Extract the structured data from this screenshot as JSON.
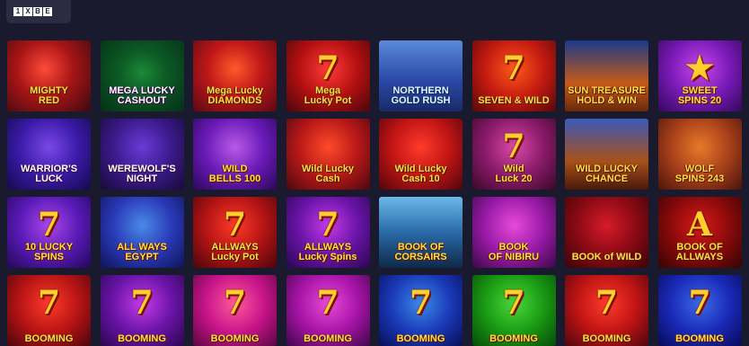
{
  "provider_logo": [
    "1",
    "X",
    "B",
    "E"
  ],
  "games": [
    {
      "title": "MIGHTY\nRED",
      "glyph": "",
      "bg": "radial-gradient(circle at 45% 40%, #ff4a3a 0%, #a81515 45%, #3a0a12 100%)",
      "text": "yellow"
    },
    {
      "title": "MEGA LUCKY\nCASHOUT",
      "glyph": "",
      "bg": "radial-gradient(ellipse at 50% 45%, #1a8a3a 0%, #0d5a24 40%, #043018 100%)",
      "text": "white"
    },
    {
      "title": "Mega Lucky\nDIAMONDS",
      "glyph": "",
      "bg": "radial-gradient(circle at 50% 40%, #ff5a2a 0%, #c01818 45%, #5a0814 100%)",
      "text": "yellow"
    },
    {
      "title": "Mega\nLucky Pot",
      "glyph": "7",
      "bg": "radial-gradient(circle at 50% 40%, #ff3b3b 0%, #b41010 50%, #4a060c 100%)",
      "text": "yellow"
    },
    {
      "title": "NORTHERN\nGOLD RUSH",
      "glyph": "",
      "bg": "linear-gradient(180deg, #5a8ad8 0%, #2a4aa8 55%, #1a2a6a 100%)",
      "text": "cyan"
    },
    {
      "title": "SEVEN & WILD",
      "glyph": "7",
      "bg": "radial-gradient(circle at 50% 40%, #ff5a1a 0%, #c41a10 50%, #560808 100%)",
      "text": "yellow"
    },
    {
      "title": "SUN TREASURE\nHOLD & WIN",
      "glyph": "",
      "bg": "linear-gradient(180deg, #1a3a8a 0%, #c45a1a 60%, #6a2a0a 100%)",
      "text": "yellow"
    },
    {
      "title": "SWEET\nSPINS 20",
      "glyph": "★",
      "bg": "radial-gradient(circle at 50% 40%, #c848e8 0%, #7a1ab8 50%, #34085a 100%)",
      "text": "yellow"
    },
    {
      "title": "WARRIOR'S\nLUCK",
      "glyph": "",
      "bg": "radial-gradient(circle at 50% 40%, #7a48e8 0%, #3a1aa8 50%, #140a4a 100%)",
      "text": "white"
    },
    {
      "title": "WEREWOLF'S\nNIGHT",
      "glyph": "",
      "bg": "radial-gradient(circle at 50% 40%, #6a3ad8 0%, #3a1a8a 50%, #180a3a 100%)",
      "text": "white"
    },
    {
      "title": "WILD\nBELLS 100",
      "glyph": "",
      "bg": "radial-gradient(circle at 50% 40%, #b85ae8 0%, #6a1ab8 50%, #2a0858 100%)",
      "text": "yellow"
    },
    {
      "title": "Wild Lucky\nCash",
      "glyph": "",
      "bg": "radial-gradient(circle at 50% 40%, #ff4a2a 0%, #b81818 50%, #4a0810 100%)",
      "text": "yellow"
    },
    {
      "title": "Wild Lucky\nCash 10",
      "glyph": "",
      "bg": "radial-gradient(circle at 50% 40%, #ff3a2a 0%, #c01414 50%, #4e060e 100%)",
      "text": "yellow"
    },
    {
      "title": "Wild\nLuck 20",
      "glyph": "7",
      "bg": "radial-gradient(circle at 50% 40%, #d84aa8 0%, #8a1a6a 50%, #3a0828 100%)",
      "text": "yellow"
    },
    {
      "title": "WILD LUCKY\nCHANCE",
      "glyph": "",
      "bg": "linear-gradient(180deg, #3a5ab8 0%, #a8501a 60%, #4a1a0a 100%)",
      "text": "yellow"
    },
    {
      "title": "WOLF\nSPINS 243",
      "glyph": "",
      "bg": "radial-gradient(circle at 50% 40%, #e87a2a 0%, #a8401a 50%, #4a140a 100%)",
      "text": "yellow"
    },
    {
      "title": "10 LUCKY\nSPINS",
      "glyph": "7",
      "bg": "radial-gradient(circle at 50% 40%, #a848e8 0%, #5a1ab8 50%, #220858 100%)",
      "text": "yellow"
    },
    {
      "title": "ALL WAYS\nEGYPT",
      "glyph": "",
      "bg": "radial-gradient(circle at 50% 40%, #4a8ae8 0%, #2a3ab8 50%, #0e1458 100%)",
      "text": "yellow"
    },
    {
      "title": "ALLWAYS\nLucky Pot",
      "glyph": "7",
      "bg": "radial-gradient(circle at 50% 40%, #ff3a2a 0%, #b41414 50%, #4a060c 100%)",
      "text": "yellow"
    },
    {
      "title": "ALLWAYS\nLucky Spins",
      "glyph": "7",
      "bg": "radial-gradient(circle at 50% 40%, #c43ae8 0%, #6a14a8 50%, #2a0650 100%)",
      "text": "yellow"
    },
    {
      "title": "BOOK OF\nCORSAIRS",
      "glyph": "",
      "bg": "linear-gradient(180deg, #6ab8e8 0%, #2a6aa8 50%, #0e2a4a 100%)",
      "text": "yellow"
    },
    {
      "title": "BOOK\nOF NIBIRU",
      "glyph": "",
      "bg": "radial-gradient(circle at 50% 40%, #e84ad8 0%, #9a1aa8 50%, #3a0848 100%)",
      "text": "yellow"
    },
    {
      "title": "BOOK of WILD",
      "glyph": "",
      "bg": "radial-gradient(circle at 50% 40%, #d81a2a 0%, #8a0a14 50%, #3a0408 100%)",
      "text": "yellow"
    },
    {
      "title": "BOOK OF\nALLWAYS",
      "glyph": "A",
      "bg": "radial-gradient(circle at 50% 40%, #d81a1a 0%, #8a0a0a 50%, #340404 100%)",
      "text": "yellow"
    },
    {
      "title": "BOOMING",
      "glyph": "7",
      "bg": "radial-gradient(circle at 50% 40%, #ff3a2a 0%, #b81414 50%, #4a060c 100%)",
      "text": "yellow"
    },
    {
      "title": "BOOMING",
      "glyph": "7",
      "bg": "radial-gradient(circle at 50% 40%, #c43ae8 0%, #6a14a8 50%, #2a0650 100%)",
      "text": "yellow"
    },
    {
      "title": "BOOMING",
      "glyph": "7",
      "bg": "radial-gradient(circle at 50% 40%, #ff5a9a 0%, #c8148a 50%, #5a0640 100%)",
      "text": "yellow"
    },
    {
      "title": "BOOMING",
      "glyph": "7",
      "bg": "radial-gradient(circle at 50% 40%, #e84ad8 0%, #a814a8 50%, #40064a 100%)",
      "text": "yellow"
    },
    {
      "title": "BOOMING",
      "glyph": "7",
      "bg": "radial-gradient(circle at 50% 40%, #3a8ae8 0%, #1a3ab8 50%, #080e58 100%)",
      "text": "yellow"
    },
    {
      "title": "BOOMING",
      "glyph": "7",
      "bg": "radial-gradient(circle at 50% 40%, #48d83a 0%, #1a9a14 50%, #064a06 100%)",
      "text": "yellow"
    },
    {
      "title": "BOOMING",
      "glyph": "7",
      "bg": "radial-gradient(circle at 50% 40%, #ff3a2a 0%, #c01414 50%, #4e060e 100%)",
      "text": "yellow"
    },
    {
      "title": "BOOMING",
      "glyph": "7",
      "bg": "radial-gradient(circle at 50% 40%, #3a6ae8 0%, #1a2ab8 50%, #080a58 100%)",
      "text": "yellow"
    }
  ]
}
